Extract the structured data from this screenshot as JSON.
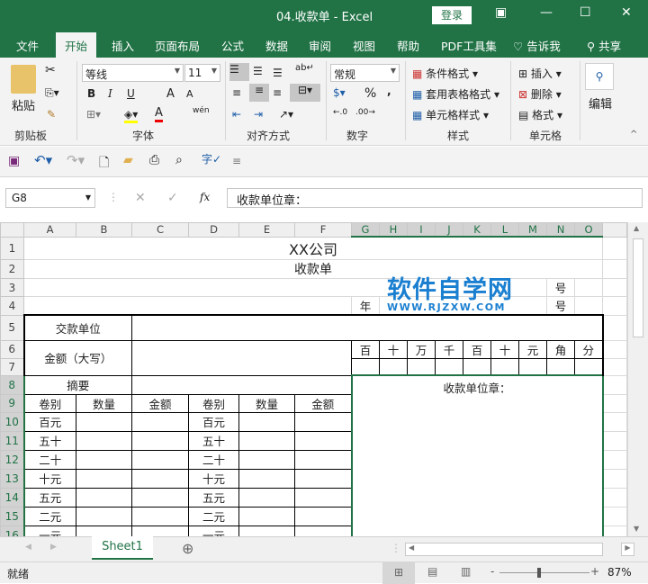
{
  "window": {
    "title": "04.收款单  -  Excel",
    "login": "登录",
    "ribbon_display_icon": "ribbon-display-icon",
    "minimize": "—",
    "maximize": "☐",
    "close": "✕"
  },
  "tabs": [
    "文件",
    "开始",
    "插入",
    "页面布局",
    "公式",
    "数据",
    "审阅",
    "视图",
    "帮助",
    "PDF工具集",
    "告诉我",
    "共享"
  ],
  "ribbon": {
    "clipboard": {
      "paste": "粘贴",
      "label": "剪贴板"
    },
    "font": {
      "name": "等线",
      "size": "11",
      "bold": "B",
      "italic": "I",
      "underline": "U",
      "grow": "A",
      "shrink": "A",
      "phonetic": "wén",
      "label": "字体"
    },
    "alignment": {
      "label": "对齐方式"
    },
    "number": {
      "format": "常规",
      "percent": "%",
      "comma": ",",
      "label": "数字"
    },
    "styles": {
      "conditional": "条件格式",
      "table": "套用表格格式",
      "cell": "单元格样式",
      "label": "样式"
    },
    "cells": {
      "insert": "插入",
      "delete": "删除",
      "format": "格式",
      "label": "单元格"
    },
    "editing": {
      "label": "编辑"
    }
  },
  "formula_bar": {
    "name_box": "G8",
    "fx": "fx",
    "content": "收款单位章："
  },
  "columns": [
    "A",
    "B",
    "C",
    "D",
    "E",
    "F",
    "G",
    "H",
    "I",
    "J",
    "K",
    "L",
    "M",
    "N",
    "O"
  ],
  "rows": [
    "1",
    "2",
    "3",
    "4",
    "5",
    "6",
    "7",
    "8",
    "9",
    "10",
    "11",
    "12",
    "13",
    "14",
    "15",
    "16"
  ],
  "sheet": {
    "title": "XX公司",
    "subtitle": "收款单",
    "hao": "号",
    "year": "年",
    "payer": "交款单位",
    "amount_upper": "金额（大写）",
    "summary": "摘要",
    "stamp": "收款单位章：",
    "digits": [
      "百",
      "十",
      "万",
      "千",
      "百",
      "十",
      "元",
      "角",
      "分"
    ],
    "headers": [
      "卷别",
      "数量",
      "金额",
      "卷别",
      "数量",
      "金额"
    ],
    "denoms": [
      "百元",
      "五十",
      "二十",
      "十元",
      "五元",
      "二元",
      "一元"
    ]
  },
  "watermark": {
    "cn": "软件自学网",
    "en": "WWW.RJZXW.COM"
  },
  "sheet_tabs": [
    "Sheet1"
  ],
  "status": {
    "text": "就绪",
    "zoom": "87%",
    "zoom_level": 87
  },
  "colors": {
    "accent": "#217346",
    "watermark": "#1a7fd0"
  }
}
